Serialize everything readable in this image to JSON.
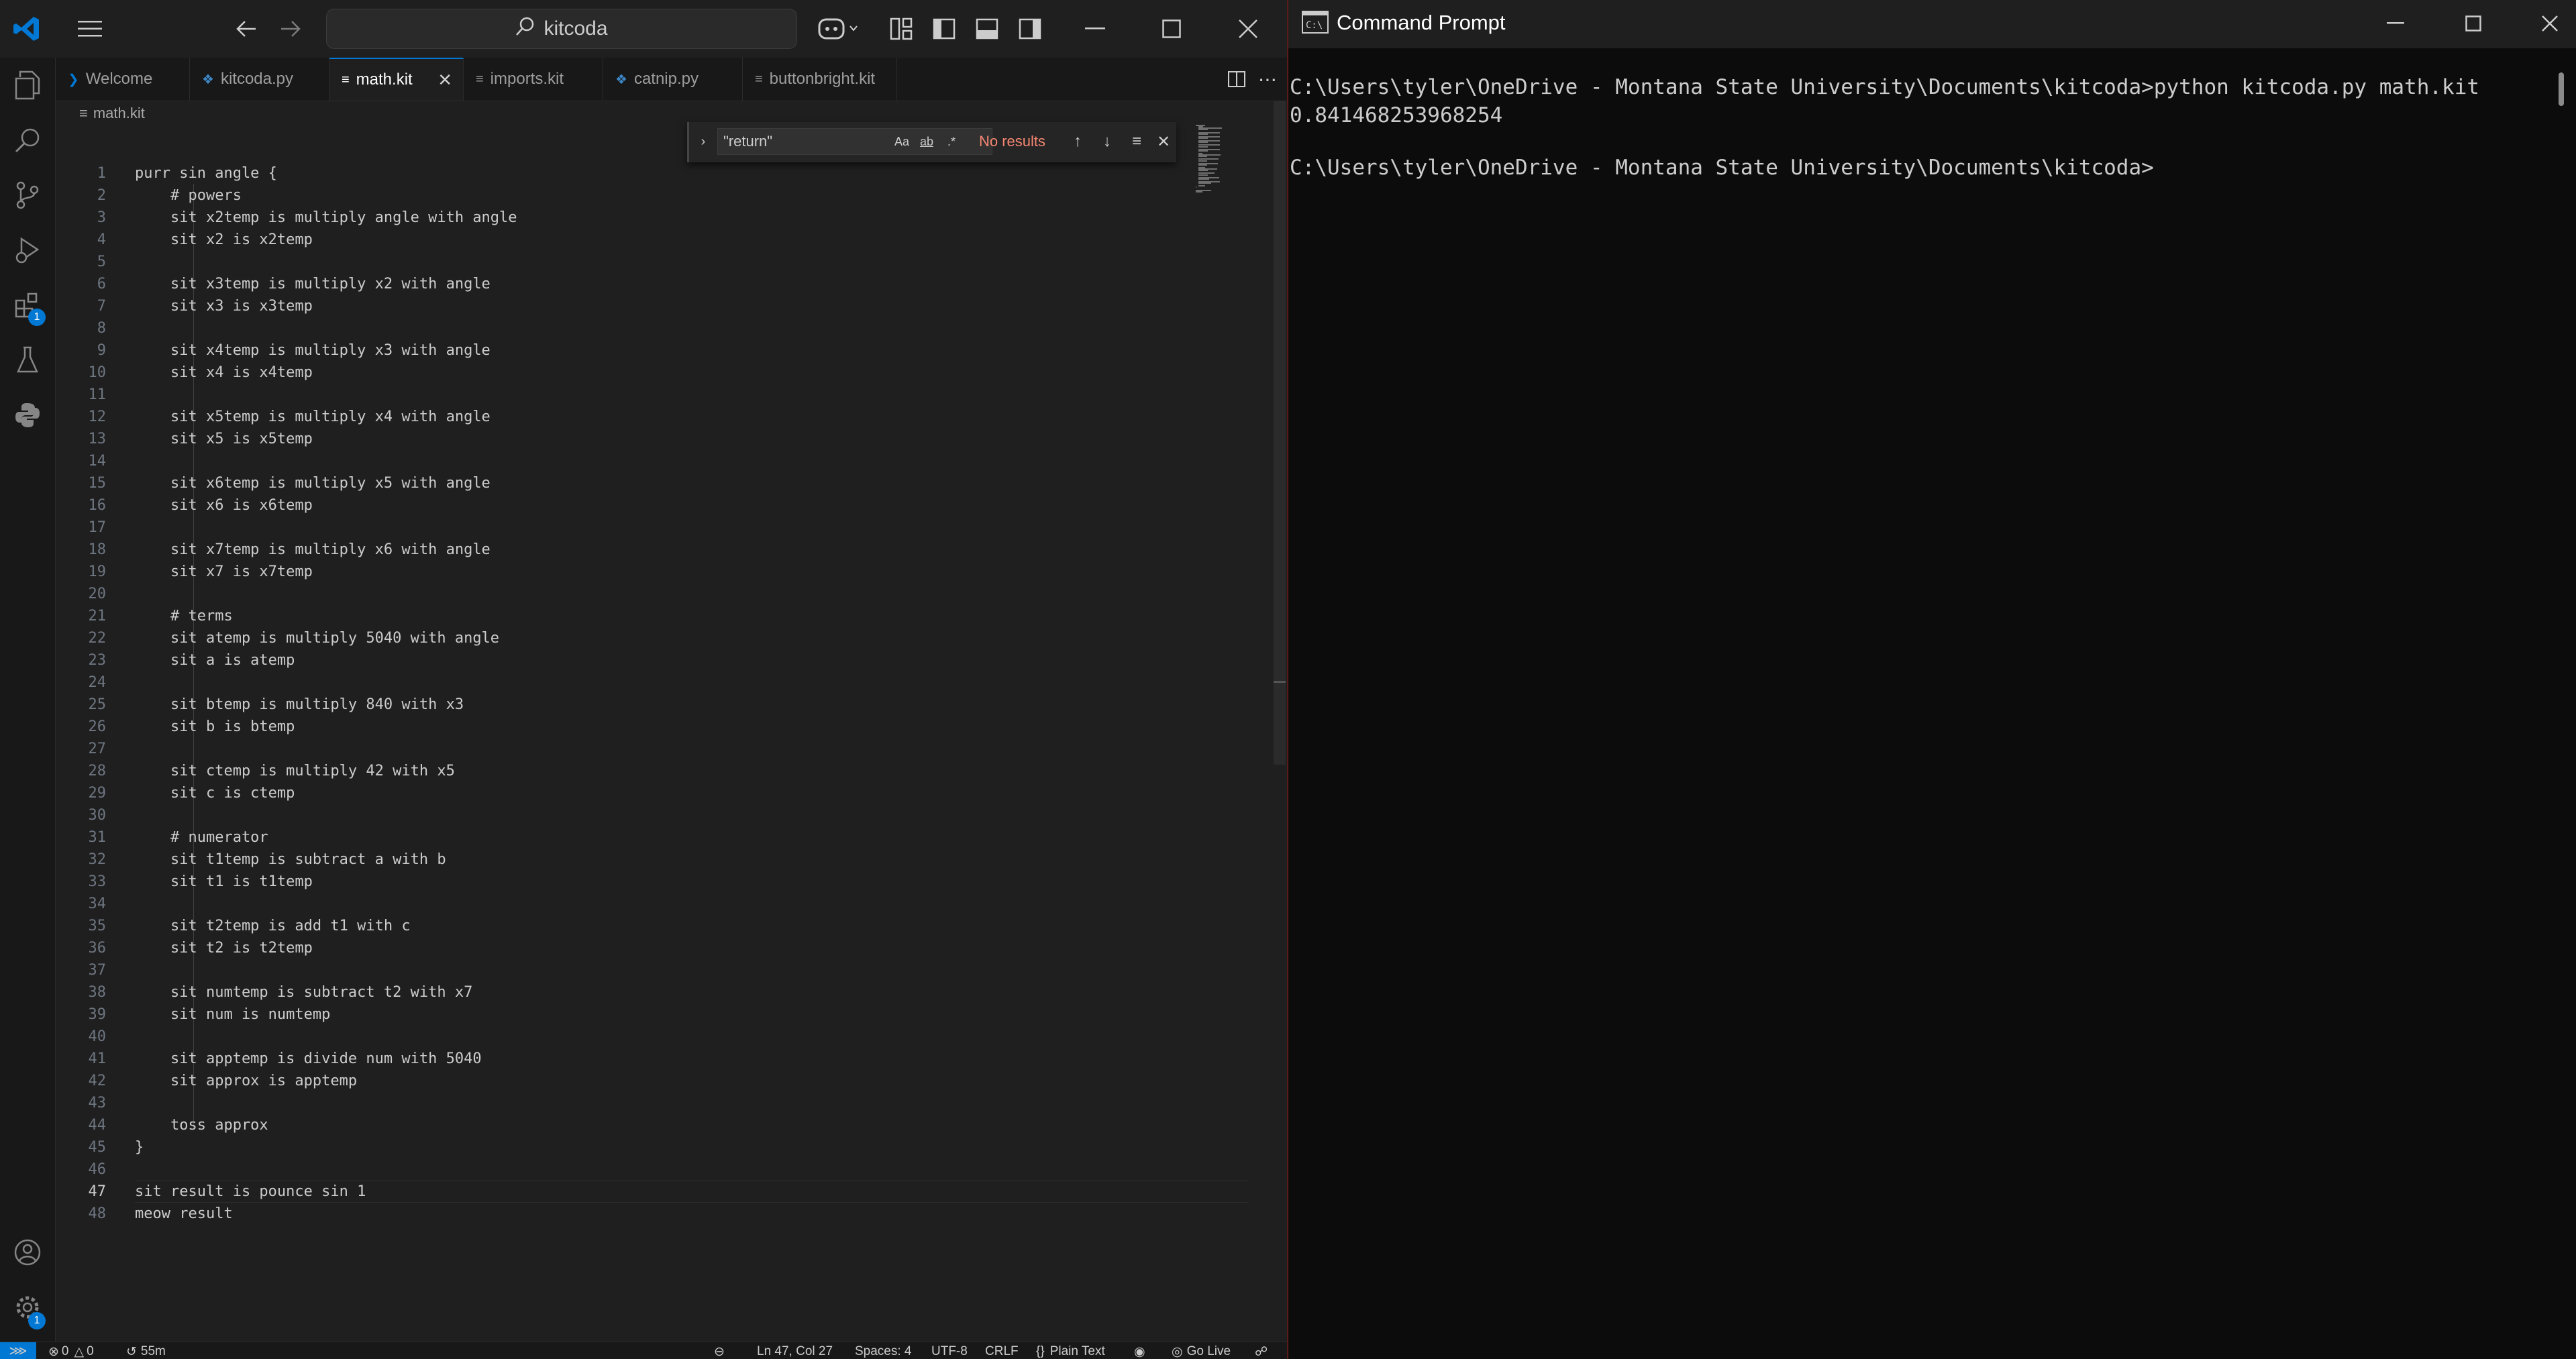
{
  "vscode": {
    "search_text": "kitcoda",
    "tabs": [
      {
        "label": "Welcome",
        "icon": "vscode-icon"
      },
      {
        "label": "kitcoda.py",
        "icon": "python-icon"
      },
      {
        "label": "math.kit",
        "icon": "lines-icon",
        "active": true
      },
      {
        "label": "imports.kit",
        "icon": "lines-icon"
      },
      {
        "label": "catnip.py",
        "icon": "python-icon"
      },
      {
        "label": "buttonbright.kit",
        "icon": "lines-icon"
      }
    ],
    "breadcrumb": "math.kit",
    "find": {
      "query": "\"return\"",
      "case_label": "Aa",
      "word_label": "ab",
      "regex_label": ".*",
      "status": "No results"
    },
    "code": [
      {
        "n": "1",
        "t": "purr sin angle {"
      },
      {
        "n": "2",
        "t": "    # powers"
      },
      {
        "n": "3",
        "t": "    sit x2temp is multiply angle with angle"
      },
      {
        "n": "4",
        "t": "    sit x2 is x2temp"
      },
      {
        "n": "5",
        "t": ""
      },
      {
        "n": "6",
        "t": "    sit x3temp is multiply x2 with angle"
      },
      {
        "n": "7",
        "t": "    sit x3 is x3temp"
      },
      {
        "n": "8",
        "t": ""
      },
      {
        "n": "9",
        "t": "    sit x4temp is multiply x3 with angle"
      },
      {
        "n": "10",
        "t": "    sit x4 is x4temp"
      },
      {
        "n": "11",
        "t": ""
      },
      {
        "n": "12",
        "t": "    sit x5temp is multiply x4 with angle"
      },
      {
        "n": "13",
        "t": "    sit x5 is x5temp"
      },
      {
        "n": "14",
        "t": ""
      },
      {
        "n": "15",
        "t": "    sit x6temp is multiply x5 with angle"
      },
      {
        "n": "16",
        "t": "    sit x6 is x6temp"
      },
      {
        "n": "17",
        "t": ""
      },
      {
        "n": "18",
        "t": "    sit x7temp is multiply x6 with angle"
      },
      {
        "n": "19",
        "t": "    sit x7 is x7temp"
      },
      {
        "n": "20",
        "t": ""
      },
      {
        "n": "21",
        "t": "    # terms"
      },
      {
        "n": "22",
        "t": "    sit atemp is multiply 5040 with angle"
      },
      {
        "n": "23",
        "t": "    sit a is atemp"
      },
      {
        "n": "24",
        "t": ""
      },
      {
        "n": "25",
        "t": "    sit btemp is multiply 840 with x3"
      },
      {
        "n": "26",
        "t": "    sit b is btemp"
      },
      {
        "n": "27",
        "t": ""
      },
      {
        "n": "28",
        "t": "    sit ctemp is multiply 42 with x5"
      },
      {
        "n": "29",
        "t": "    sit c is ctemp"
      },
      {
        "n": "30",
        "t": ""
      },
      {
        "n": "31",
        "t": "    # numerator"
      },
      {
        "n": "32",
        "t": "    sit t1temp is subtract a with b"
      },
      {
        "n": "33",
        "t": "    sit t1 is t1temp"
      },
      {
        "n": "34",
        "t": ""
      },
      {
        "n": "35",
        "t": "    sit t2temp is add t1 with c"
      },
      {
        "n": "36",
        "t": "    sit t2 is t2temp"
      },
      {
        "n": "37",
        "t": ""
      },
      {
        "n": "38",
        "t": "    sit numtemp is subtract t2 with x7"
      },
      {
        "n": "39",
        "t": "    sit num is numtemp"
      },
      {
        "n": "40",
        "t": ""
      },
      {
        "n": "41",
        "t": "    sit apptemp is divide num with 5040"
      },
      {
        "n": "42",
        "t": "    sit approx is apptemp"
      },
      {
        "n": "43",
        "t": ""
      },
      {
        "n": "44",
        "t": "    toss approx"
      },
      {
        "n": "45",
        "t": "}"
      },
      {
        "n": "46",
        "t": ""
      },
      {
        "n": "47",
        "t": "sit result is pounce sin 1"
      },
      {
        "n": "48",
        "t": "meow result"
      }
    ],
    "current_line": 47,
    "activity_badges": {
      "extensions": "1",
      "accounts": "1"
    },
    "status": {
      "problems": "0",
      "warnings": "0",
      "time": "55m",
      "position": "Ln 47, Col 27",
      "spaces": "Spaces: 4",
      "encoding": "UTF-8",
      "eol": "CRLF",
      "language": "Plain Text",
      "golive": "Go Live"
    }
  },
  "cmd": {
    "title": "Command Prompt",
    "lines": [
      "C:\\Users\\tyler\\OneDrive - Montana State University\\Documents\\kitcoda>python kitcoda.py math.kit",
      "0.841468253968254",
      "",
      "C:\\Users\\tyler\\OneDrive - Montana State University\\Documents\\kitcoda>"
    ]
  },
  "colors": {
    "accent": "#0078d4",
    "error": "#f48771"
  }
}
